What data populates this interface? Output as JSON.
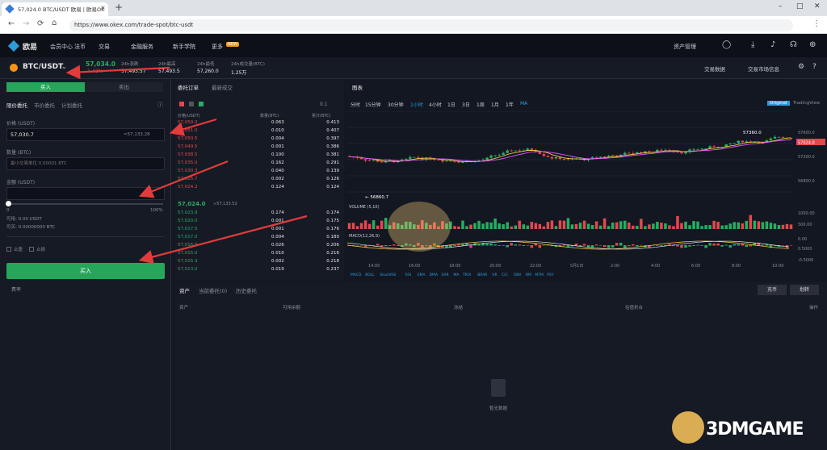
{
  "browser": {
    "tab_title": "57,024.0 BTC/USDT 欧易 | 欧易OK",
    "url": "https://www.okex.com/trade-spot/btc-usdt",
    "new_tab": "+"
  },
  "nav": {
    "logo": "欧易",
    "items": [
      "会员中心",
      "法币",
      "交易",
      "金融服务",
      "新手学院"
    ],
    "more_label": "更多",
    "more_badge": "NEW",
    "account": "资产管理"
  },
  "ticker": {
    "pair": "BTC/USDT",
    "last_price": "57,034.0",
    "change": "-1.42%",
    "fields": [
      {
        "label": "24h涨跌",
        "value": "57,493.57"
      },
      {
        "label": "24h最高",
        "value": "57,493.5"
      },
      {
        "label": "24h最低",
        "value": "57,260.0"
      },
      {
        "label": "24h成交量(BTC)",
        "value": "1.25万"
      }
    ],
    "right_links": [
      "交易数据",
      "交易市场信息"
    ]
  },
  "order": {
    "buy_tab": "买入",
    "sell_tab": "卖出",
    "types": [
      "限价委托",
      "市价委托",
      "计划委托"
    ],
    "price_label": "价格 (USDT)",
    "price_value": "57,030.7",
    "price_hint": "≈57,133.28",
    "amount_label": "数量 (BTC)",
    "amount_placeholder": "最小交易单位 0.00001 BTC",
    "total_label": "金额 (USDT)",
    "slider_min": "0",
    "slider_max": "100%",
    "available_usdt": "可用: 0.00 USDT",
    "available_btc": "可买: 0.00000000 BTC",
    "checkbox_a": "止盈",
    "checkbox_b": "止损",
    "submit": "买入",
    "fee_link": "费率"
  },
  "book": {
    "tabs": [
      "委托订单",
      "最新成交"
    ],
    "depth": "0.1",
    "headers": [
      "价格(USDT)",
      "数量(BTC)",
      "累计(BTC)"
    ],
    "asks": [
      [
        "57,059.0",
        "0.063",
        "0.413"
      ],
      [
        "57,051.0",
        "0.010",
        "0.407"
      ],
      [
        "57,050.5",
        "0.004",
        "0.397"
      ],
      [
        "57,049.5",
        "0.001",
        "0.386"
      ],
      [
        "57,038.5",
        "0.100",
        "0.381"
      ],
      [
        "57,035.0",
        "0.162",
        "0.291"
      ],
      [
        "57,030.3",
        "0.040",
        "0.139"
      ],
      [
        "57,025.7",
        "0.002",
        "0.126"
      ],
      [
        "57,024.2",
        "0.124",
        "0.124"
      ]
    ],
    "mid_price": "57,024.0",
    "mid_usd": "≈57,133.52",
    "bids": [
      [
        "57,023.9",
        "0.174",
        "0.174"
      ],
      [
        "57,020.0",
        "0.001",
        "0.175"
      ],
      [
        "57,017.5",
        "0.001",
        "0.176"
      ],
      [
        "57,017.0",
        "0.004",
        "0.180"
      ],
      [
        "57,016.0",
        "0.026",
        "0.206"
      ],
      [
        "57,015.0",
        "0.010",
        "0.216"
      ],
      [
        "57,015.3",
        "0.002",
        "0.218"
      ],
      [
        "57,013.0",
        "0.019",
        "0.237"
      ]
    ]
  },
  "chart": {
    "title": "图表",
    "intervals": [
      "分时",
      "15分钟",
      "30分钟",
      "1小时",
      "4小时",
      "1日",
      "3日",
      "1周",
      "1月",
      "1年"
    ],
    "mode_a": "Original",
    "mode_b": "TradingView",
    "ma_label": "MA",
    "peak_label": "57360.0",
    "low_label": "56860.7",
    "last_tag": "57024.0",
    "volume_label": "VOLUME (5,10)",
    "macd_label": "MACD(12,26,9)",
    "y_ticks": [
      "57600.0",
      "57200.0",
      "56800.0",
      "1000.00",
      "500.00",
      "0.00",
      "0.5000",
      "-0.5000"
    ],
    "x_ticks": [
      "14:00",
      "16:00",
      "18:00",
      "20:00",
      "22:00",
      "5月1日",
      "2:00",
      "4:00",
      "6:00",
      "8:00",
      "10:00"
    ],
    "indicators": [
      "MACD",
      "BOLL",
      "StochRSI",
      "RSI",
      "EMA",
      "DMA",
      "SAR",
      "MA",
      "TRIX",
      "BRAR",
      "VR",
      "CCI",
      "OBV",
      "WR",
      "MTM",
      "PSY"
    ]
  },
  "assets": {
    "tabs": [
      "资产",
      "当前委托(0)",
      "历史委托"
    ],
    "btn_a": "充币",
    "btn_b": "划转",
    "headers": [
      "资产",
      "可用余额",
      "冻结",
      "估值折合",
      "操作"
    ],
    "empty": "暂无数据"
  },
  "colors": {
    "up": "#27ae60",
    "down": "#e2494c",
    "accent": "#2d9cdb",
    "buy": "#26a65b"
  },
  "watermark": "3DMGAME"
}
